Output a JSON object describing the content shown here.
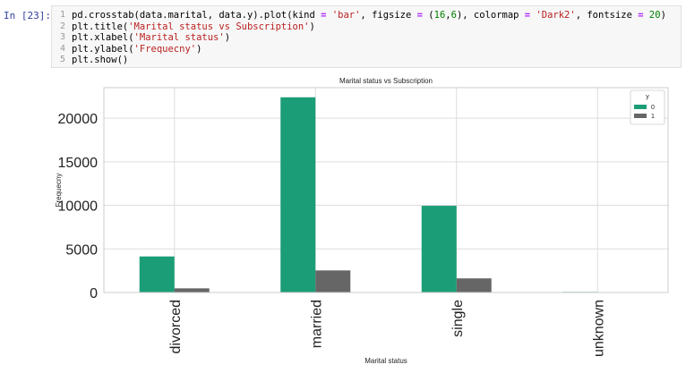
{
  "prompt": "In [23]:",
  "code": {
    "line_numbers": [
      "1",
      "2",
      "3",
      "4",
      "5"
    ],
    "lines": [
      [
        {
          "t": "pd.crosstab(data.marital, data.y).plot(kind ",
          "c": "plain"
        },
        {
          "t": "=",
          "c": "op"
        },
        {
          "t": " ",
          "c": "plain"
        },
        {
          "t": "'bar'",
          "c": "str"
        },
        {
          "t": ", figsize ",
          "c": "plain"
        },
        {
          "t": "=",
          "c": "op"
        },
        {
          "t": " (",
          "c": "plain"
        },
        {
          "t": "16",
          "c": "num"
        },
        {
          "t": ",",
          "c": "plain"
        },
        {
          "t": "6",
          "c": "num"
        },
        {
          "t": "), colormap ",
          "c": "plain"
        },
        {
          "t": "=",
          "c": "op"
        },
        {
          "t": " ",
          "c": "plain"
        },
        {
          "t": "'Dark2'",
          "c": "str"
        },
        {
          "t": ", fontsize ",
          "c": "plain"
        },
        {
          "t": "=",
          "c": "op"
        },
        {
          "t": " ",
          "c": "plain"
        },
        {
          "t": "20",
          "c": "num"
        },
        {
          "t": ")",
          "c": "plain"
        }
      ],
      [
        {
          "t": "plt.title(",
          "c": "plain"
        },
        {
          "t": "'Marital status vs Subscription'",
          "c": "str"
        },
        {
          "t": ")",
          "c": "plain"
        }
      ],
      [
        {
          "t": "plt.xlabel(",
          "c": "plain"
        },
        {
          "t": "'Marital status'",
          "c": "str"
        },
        {
          "t": ")",
          "c": "plain"
        }
      ],
      [
        {
          "t": "plt.ylabel(",
          "c": "plain"
        },
        {
          "t": "'Frequecny'",
          "c": "str"
        },
        {
          "t": ")",
          "c": "plain"
        }
      ],
      [
        {
          "t": "plt.show()",
          "c": "plain"
        }
      ]
    ]
  },
  "chart_data": {
    "type": "bar",
    "title": "Marital status vs Subscription",
    "xlabel": "Marital status",
    "ylabel": "Frequecny",
    "categories": [
      "divorced",
      "married",
      "single",
      "unknown"
    ],
    "series": [
      {
        "name": "0",
        "values": [
          4136,
          22396,
          9948,
          68
        ],
        "color": "#1b9e77"
      },
      {
        "name": "1",
        "values": [
          476,
          2532,
          1620,
          12
        ],
        "color": "#666666"
      }
    ],
    "ylim": [
      0,
      23500
    ],
    "yticks": [
      0,
      5000,
      10000,
      15000,
      20000
    ],
    "legend_title": "y",
    "legend_position": "top-right",
    "grid": true
  }
}
